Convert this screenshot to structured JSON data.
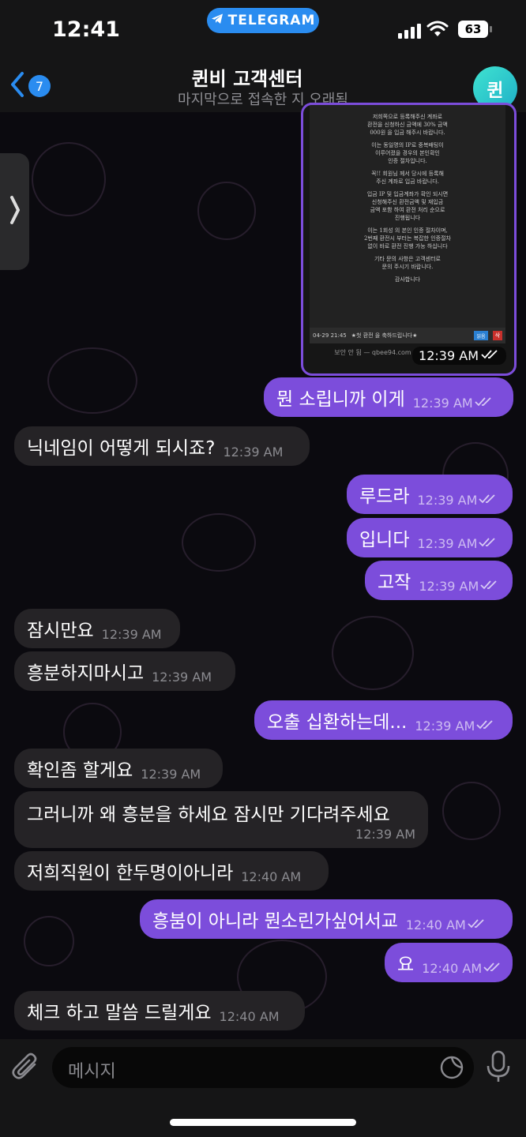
{
  "status_bar": {
    "time": "12:41",
    "pill_label": "TELEGRAM",
    "battery": "63"
  },
  "header": {
    "back_count": "7",
    "title": "퀸비 고객센터",
    "subtitle": "마지막으로 접속한 지 오래됨",
    "avatar_letter": "퀸"
  },
  "image_message": {
    "lines": [
      "저희쪽으로 등록해주신 계좌로",
      "환전을 신청하신 금액에 30% 금액",
      "000원 을 입금 해주시 바랍니다.",
      "",
      "이는 동일명의 IP로 중복배팅이",
      "이루어졌을 경우의 본인확인",
      "인증 절차입니다.",
      "",
      "꼭!! 회원님 께서 당시에 등록해",
      "주신 계좌로 입금 바랍니다.",
      "",
      "입금 IP 및 입금계좌가 확인 되시면",
      "신청해주신 환전금액 및 재입금",
      "금액 포함 하여 환전 처리 순으로",
      "진행됩니다",
      "",
      "이는 1회성 의 본인 인증 절차이며,",
      "2번째 환전시 부터는 복잡한 인증절차",
      "없이 바로 환전 진행 가능 하십니다",
      "",
      "기타 문의 사항은 고객센터로",
      "문의 주시기 바랍니다.",
      "",
      "감사합니다"
    ],
    "row_date": "04-29 21:45",
    "row_text": "★첫 환전 을 축하드립니다★",
    "row_btn_read": "읽음",
    "row_btn_del": "삭",
    "url": "보안 안 됨 — qbee94.com",
    "time": "12:39 AM"
  },
  "messages": [
    {
      "dir": "out",
      "text": "뭔 소립니까 이게",
      "time": "12:39 AM"
    },
    {
      "dir": "in",
      "text": "닉네임이 어떻게 되시죠?",
      "time": "12:39 AM"
    },
    {
      "dir": "out",
      "text": "루드라",
      "time": "12:39 AM"
    },
    {
      "dir": "out",
      "text": "입니다",
      "time": "12:39 AM"
    },
    {
      "dir": "out",
      "text": "고작",
      "time": "12:39 AM"
    },
    {
      "dir": "in",
      "text": "잠시만요",
      "time": "12:39 AM"
    },
    {
      "dir": "in",
      "text": "흥분하지마시고",
      "time": "12:39 AM"
    },
    {
      "dir": "out",
      "text": "오출 십환하는데...",
      "time": "12:39 AM"
    },
    {
      "dir": "in",
      "text": "확인좀 할게요",
      "time": "12:39 AM"
    },
    {
      "dir": "in",
      "text": "그러니까 왜 흥분을 하세요 잠시만 기다려주세요",
      "time": "12:39 AM"
    },
    {
      "dir": "in",
      "text": "저희직원이 한두명이아니라",
      "time": "12:40 AM"
    },
    {
      "dir": "out",
      "text": "흥붐이 아니라 뭔소린가싶어서교",
      "time": "12:40 AM"
    },
    {
      "dir": "out",
      "text": "요",
      "time": "12:40 AM"
    },
    {
      "dir": "in",
      "text": "체크 하고 말씀 드릴게요",
      "time": "12:40 AM"
    }
  ],
  "input": {
    "placeholder": "메시지"
  },
  "colors": {
    "outgoing": "#7c4ddb",
    "incoming": "#252326",
    "accent": "#2a8cf0"
  }
}
